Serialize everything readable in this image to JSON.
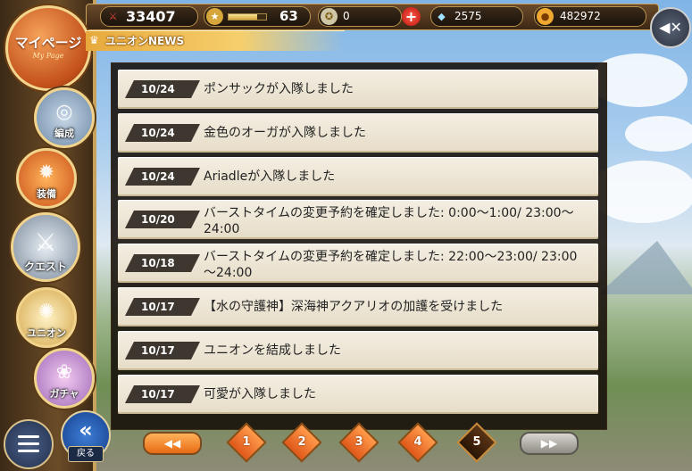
{
  "header": {
    "power": "33407",
    "level": "63",
    "level_progress": 0.75,
    "medals": "0",
    "crystals": "2575",
    "gold": "482972"
  },
  "nav": {
    "mypage_label": "マイページ",
    "mypage_sub": "My Page",
    "items": [
      {
        "label": "編成"
      },
      {
        "label": "装備"
      },
      {
        "label": "クエスト"
      },
      {
        "label": "ユニオン"
      },
      {
        "label": "ガチャ"
      }
    ],
    "back_label": "戻る"
  },
  "news": {
    "title": "ユニオンNEWS",
    "items": [
      {
        "date": "10/24",
        "text": "ポンサックが入隊しました"
      },
      {
        "date": "10/24",
        "text": "金色のオーガが入隊しました"
      },
      {
        "date": "10/24",
        "text": "Ariadleが入隊しました"
      },
      {
        "date": "10/20",
        "text": "バーストタイムの変更予約を確定しました: 0:00～1:00/ 23:00～24:00"
      },
      {
        "date": "10/18",
        "text": "バーストタイムの変更予約を確定しました: 22:00～23:00/ 23:00～24:00"
      },
      {
        "date": "10/17",
        "text": "【水の守護神】深海神アクアリオの加護を受けました"
      },
      {
        "date": "10/17",
        "text": "ユニオンを結成しました"
      },
      {
        "date": "10/17",
        "text": "可愛が入隊しました"
      }
    ]
  },
  "pagination": {
    "pages": [
      "1",
      "2",
      "3",
      "4",
      "5"
    ],
    "current": "5"
  },
  "colors": {
    "accent_orange": "#e8a93c",
    "row_bg": "#f4efe3",
    "date_tag": "#3d372f",
    "current_page": "#3a1f0a"
  }
}
